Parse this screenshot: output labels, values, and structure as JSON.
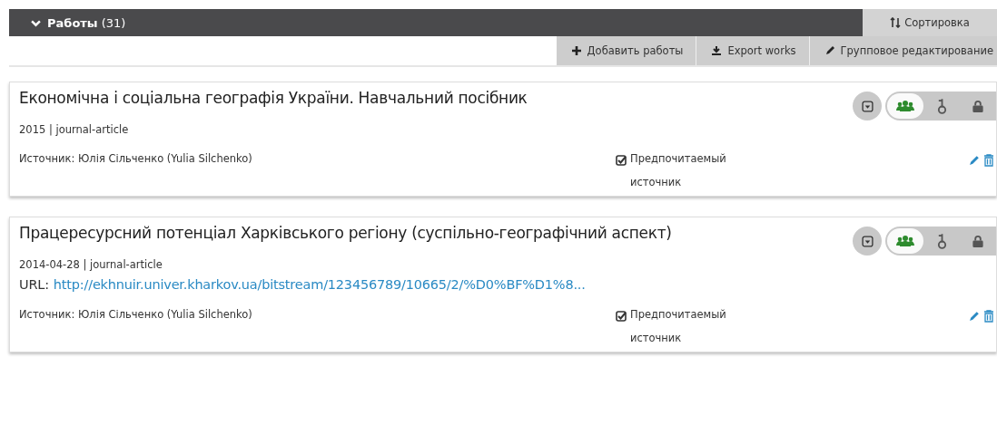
{
  "header": {
    "title": "**Работы** (31)",
    "expanded": true,
    "sort_label": "Сортировка"
  },
  "toolbar": [
    {
      "kind": "add",
      "label": "Добавить работы"
    },
    {
      "kind": "export",
      "label": "Export works"
    },
    {
      "kind": "edit",
      "label": "Групповое редактирование"
    }
  ],
  "works": [
    {
      "title": "Економічна і соціальна географія України. Навчальний посібник",
      "meta": "2015 | journal-article",
      "source": "Источник: Юлія Сільченко (Yulia Silchenko)",
      "preferred_label": "Предпочитаемый источник",
      "preferred": true,
      "privacy": [
        {
          "kind": "everyone",
          "selected": true
        },
        {
          "kind": "limited",
          "selected": false
        },
        {
          "kind": "private",
          "selected": false
        }
      ]
    },
    {
      "title": "Працересурсний потенціал Харківського регіону (суспільно-географічний аспект)",
      "meta": "2014-04-28 | journal-article",
      "url_label": "URL:",
      "url": "http://ekhnuir.univer.kharkov.ua/bitstream/123456789/10665/2/%D0%BF%D1%8...",
      "source": "Источник: Юлія Сільченко (Yulia Silchenko)",
      "preferred_label": "Предпочитаемый источник",
      "preferred": true,
      "privacy": [
        {
          "kind": "everyone",
          "selected": true
        },
        {
          "kind": "limited",
          "selected": false
        },
        {
          "kind": "private",
          "selected": false
        }
      ]
    }
  ]
}
